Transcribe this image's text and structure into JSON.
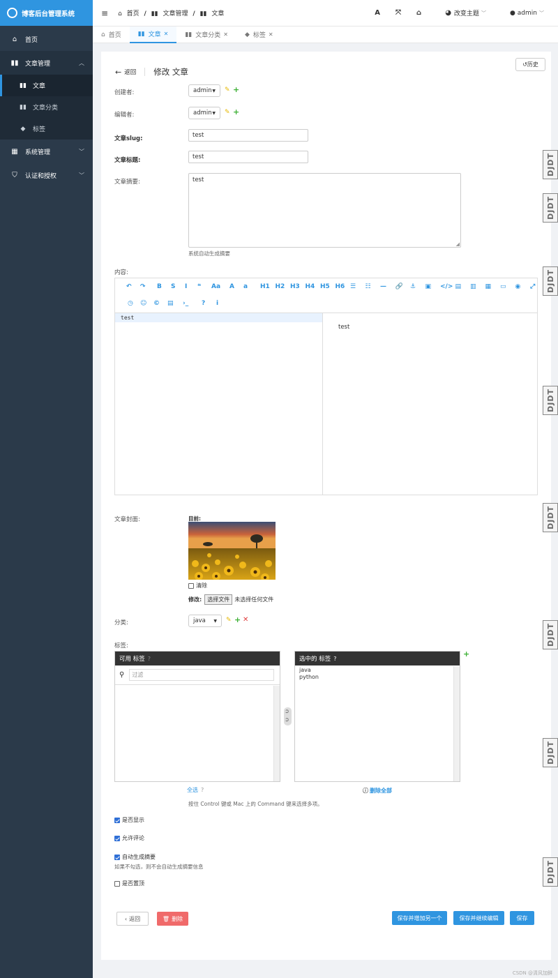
{
  "brand": {
    "title": "博客后台管理系统"
  },
  "sidebar": {
    "items": [
      {
        "label": "首页",
        "icon": "home-icon"
      },
      {
        "label": "文章管理",
        "icon": "book-icon"
      },
      {
        "label": "系统管理",
        "icon": "grid-icon"
      },
      {
        "label": "认证和授权",
        "icon": "shield-icon"
      }
    ],
    "subitems": [
      {
        "label": "文章",
        "icon": "book-icon"
      },
      {
        "label": "文章分类",
        "icon": "book-icon"
      },
      {
        "label": "标签",
        "icon": "tags-icon"
      }
    ]
  },
  "topbar": {
    "breadcrumb": [
      "首页",
      "文章管理",
      "文章"
    ],
    "theme_label": "改变主题",
    "user_label": "admin"
  },
  "tabs": [
    {
      "label": "首页"
    },
    {
      "label": "文章"
    },
    {
      "label": "文章分类"
    },
    {
      "label": "标签"
    }
  ],
  "page": {
    "back_label": "返回",
    "title": "修改 文章",
    "history_label": "历史"
  },
  "form": {
    "creator_label": "创建者:",
    "creator_value": "admin",
    "editor_label": "编辑者:",
    "editor_value": "admin",
    "slug_label": "文章slug:",
    "slug_value": "test",
    "title_label": "文章标题:",
    "title_value": "test",
    "summary_label": "文章摘要:",
    "summary_value": "test",
    "summary_help": "系统自动生成摘要",
    "content_label": "内容:",
    "content_source": "test",
    "content_preview": "test",
    "cover_label": "文章封面:",
    "cover_current_label": "目前:",
    "cover_clear_label": "清除",
    "cover_change_label": "修改:",
    "cover_choose_label": "选择文件",
    "cover_nofile_label": "未选择任何文件",
    "category_label": "分类:",
    "category_value": "java",
    "tags_label": "标签:",
    "available_tags_title": "可用 标签",
    "filter_placeholder": "过滤",
    "chosen_tags_title": "选中的 标签",
    "chosen_tags": [
      "java",
      "python"
    ],
    "choose_all_label": "全选",
    "remove_all_label": "删除全部",
    "multi_select_help": "按住 Control 键或 Mac 上的 Command 键来选择多项。",
    "show_label": "是否显示",
    "show_checked": true,
    "comment_label": "允许评论",
    "comment_checked": true,
    "auto_summary_label": "自动生成摘要",
    "auto_summary_checked": true,
    "auto_summary_help": "如果不勾选，则不会自动生成摘要信息",
    "top_label": "是否置顶",
    "top_checked": false
  },
  "toolbar": {
    "row1": [
      "↶",
      "↷",
      "B",
      "S",
      "I",
      "❝",
      "Aa",
      "A",
      "a",
      "H1",
      "H2",
      "H3",
      "H4",
      "H5",
      "H6",
      "☰",
      "☷",
      "—",
      "🔗",
      "⚓",
      "▣",
      "</>",
      "▤",
      "▥",
      "▦",
      "▭",
      "◉",
      "⤢"
    ],
    "row2": [
      "◷",
      "☺",
      "©",
      "▤",
      "›_",
      "?",
      "i"
    ]
  },
  "buttons": {
    "back": "返回",
    "delete": "删除",
    "save_add": "保存并增加另一个",
    "save_continue": "保存并继续编辑",
    "save": "保存"
  },
  "watermark": {
    "text": "DJDT"
  },
  "footer_credit": "CSDN @清风加鲜",
  "colors": {
    "accent": "#2f95e0",
    "sidebar": "#2b3a4a",
    "danger": "#f06a6a",
    "add": "#3cb034",
    "edit": "#e6b800"
  }
}
